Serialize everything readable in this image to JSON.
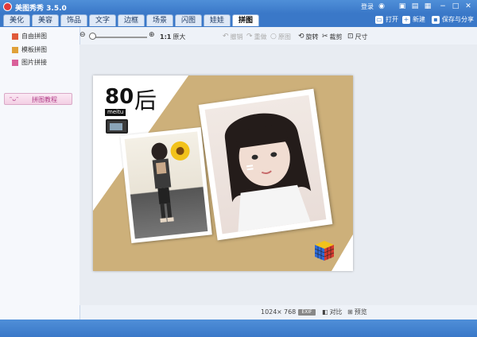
{
  "window": {
    "title": "美图秀秀 3.5.0",
    "login": "登录"
  },
  "tabs": [
    {
      "label": "美化",
      "active": false
    },
    {
      "label": "美容",
      "active": false
    },
    {
      "label": "饰品",
      "active": false
    },
    {
      "label": "文字",
      "active": false
    },
    {
      "label": "边框",
      "active": false
    },
    {
      "label": "场景",
      "active": false
    },
    {
      "label": "闪图",
      "active": false
    },
    {
      "label": "娃娃",
      "active": false
    },
    {
      "label": "拼图",
      "active": true
    }
  ],
  "topbar": {
    "open": "打开",
    "new": "新建",
    "save_share": "保存与分享"
  },
  "sidebar": {
    "items": [
      {
        "label": "自由拼图",
        "color": "#e05a3a"
      },
      {
        "label": "模板拼图",
        "color": "#e0a13a"
      },
      {
        "label": "图片拼接",
        "color": "#d9609a"
      }
    ],
    "tutorial": "拼图教程"
  },
  "toolbar": {
    "zoom_ratio": "1:1",
    "original_size": "原大",
    "undo": "撤销",
    "redo": "重做",
    "original": "原图",
    "rotate": "旋转",
    "crop": "裁剪",
    "size": "尺寸"
  },
  "canvas": {
    "title_number": "80",
    "title_char": "后",
    "tag": "meitu"
  },
  "status": {
    "width": "1024",
    "times": "×",
    "height": "768",
    "exif": "EXIF",
    "compare": "对比",
    "preview": "预览"
  },
  "colors": {
    "accent": "#3a78c8",
    "kraft": "#cdb07a"
  }
}
